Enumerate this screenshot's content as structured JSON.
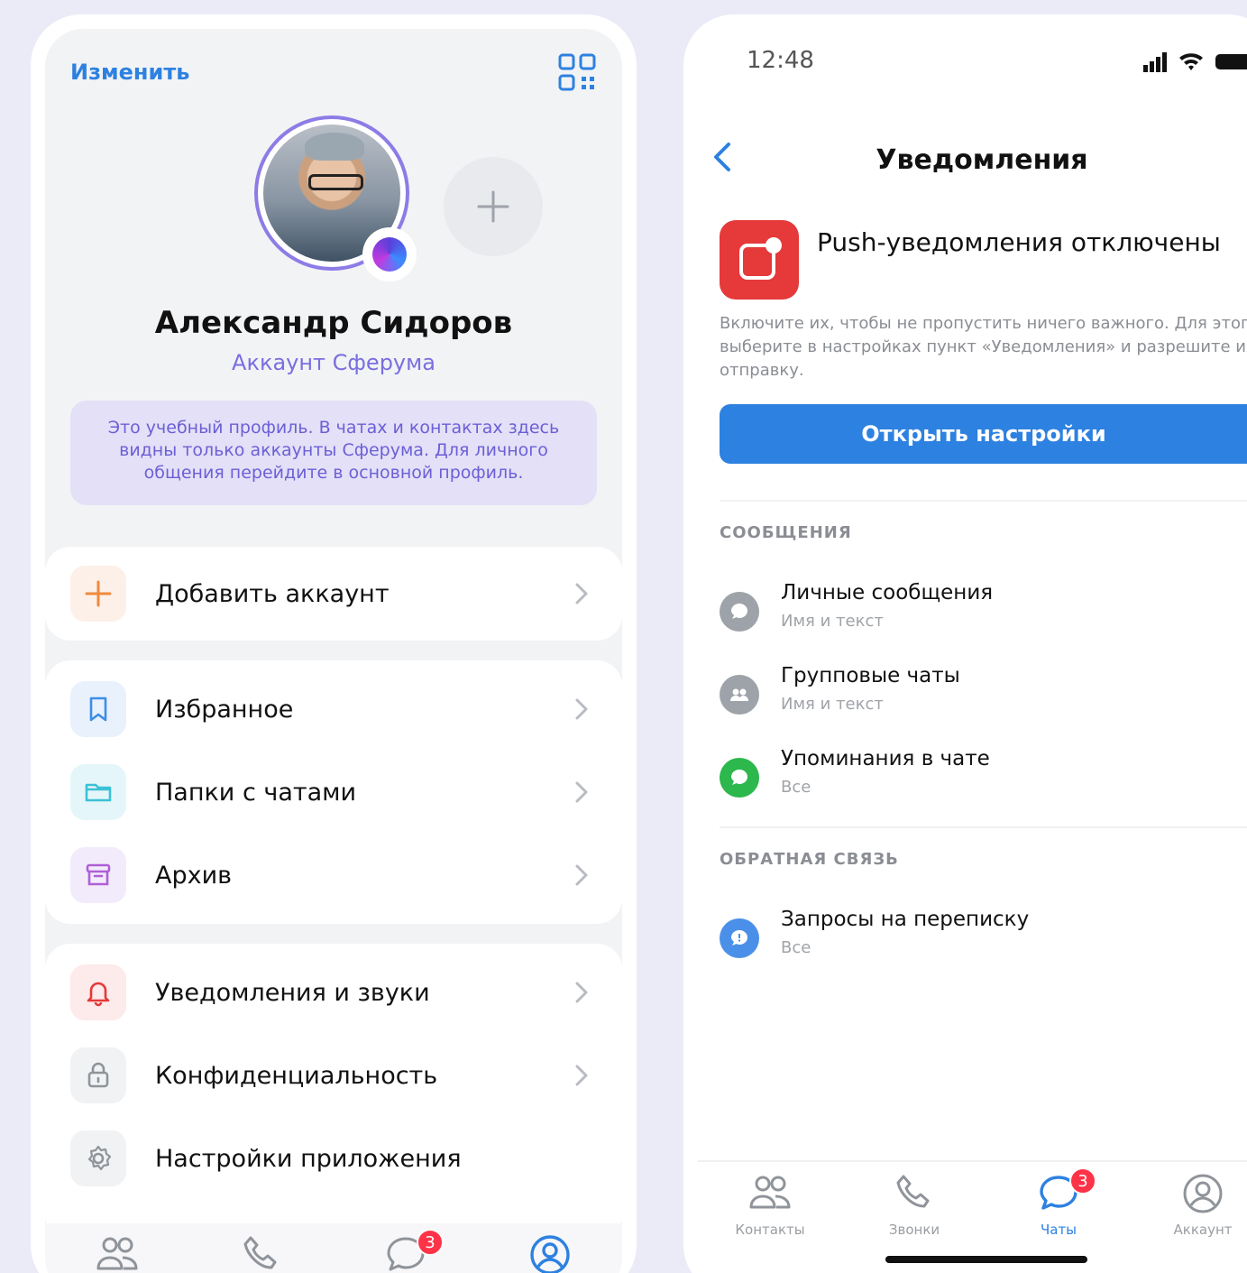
{
  "left_screen": {
    "edit_label": "Изменить",
    "profile": {
      "name": "Александр Сидоров",
      "account_type": "Аккаунт Сферума"
    },
    "info_note": "Это учебный профиль. В чатах и контактах здесь видны только аккаунты Сферума. Для личного общения перейдите в основной профиль.",
    "menu_groups": [
      [
        {
          "label": "Добавить аккаунт",
          "icon": "plus-icon"
        }
      ],
      [
        {
          "label": "Избранное",
          "icon": "bookmark-icon"
        },
        {
          "label": "Папки с чатами",
          "icon": "folder-icon"
        },
        {
          "label": "Архив",
          "icon": "archive-icon"
        }
      ],
      [
        {
          "label": "Уведомления и звуки",
          "icon": "bell-icon"
        },
        {
          "label": "Конфиденциальность",
          "icon": "lock-icon"
        },
        {
          "label": "Настройки приложения",
          "icon": "gear-icon"
        }
      ]
    ],
    "tabbar": {
      "chats_badge": "3",
      "active_tab": "account"
    }
  },
  "right_screen": {
    "status_time": "12:48",
    "title": "Уведомления",
    "push": {
      "title": "Push-уведомления отключены",
      "description": "Включите их, чтобы не пропустить ничего важного. Для этого выберите в настройках пункт «Уведомления» и разрешите их отправку.",
      "button_label": "Открыть настройки"
    },
    "sections": [
      {
        "header": "СООБЩЕНИЯ",
        "items": [
          {
            "title": "Личные сообщения",
            "subtitle": "Имя и текст",
            "icon": "message-icon",
            "color": "#9ea3a9"
          },
          {
            "title": "Групповые чаты",
            "subtitle": "Имя и текст",
            "icon": "group-icon",
            "color": "#9ea3a9"
          },
          {
            "title": "Упоминания в чате",
            "subtitle": "Все",
            "icon": "mention-icon",
            "color": "#2cb84c"
          }
        ]
      },
      {
        "header": "ОБРАТНАЯ СВЯЗЬ",
        "items": [
          {
            "title": "Запросы на переписку",
            "subtitle": "Все",
            "icon": "request-icon",
            "color": "#4a90e8"
          }
        ]
      }
    ],
    "tabbar": {
      "tabs": [
        {
          "label": "Контакты",
          "icon": "contacts-icon"
        },
        {
          "label": "Звонки",
          "icon": "phone-icon"
        },
        {
          "label": "Чаты",
          "icon": "chats-icon",
          "badge": "3"
        },
        {
          "label": "Аккаунт",
          "icon": "account-icon"
        }
      ],
      "active_tab": "Чаты"
    }
  },
  "colors": {
    "accent": "#2d81e0",
    "purple": "#7a6ee0",
    "badge": "#ff3347",
    "push_icon": "#e5393a"
  }
}
